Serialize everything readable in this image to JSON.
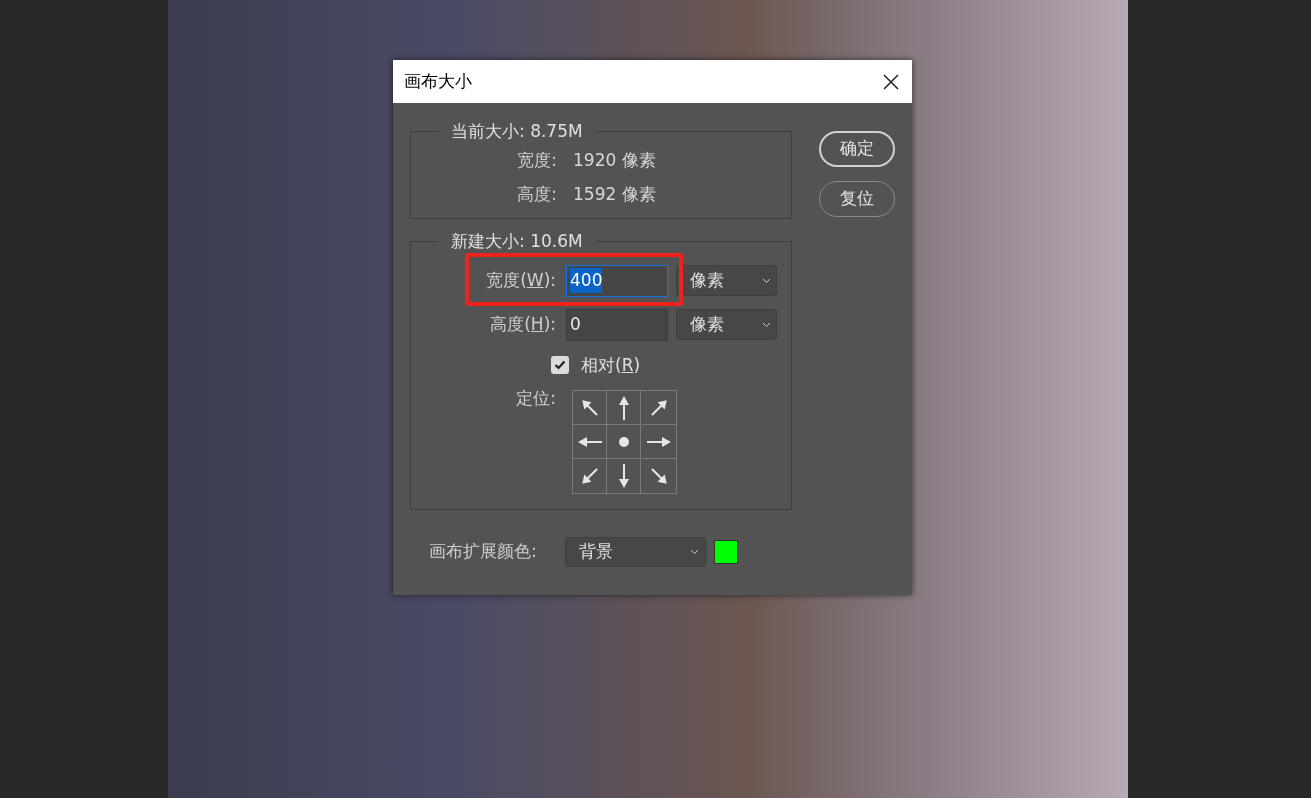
{
  "window": {
    "title": "画布大小"
  },
  "current_size": {
    "legend": "当前大小: 8.75M",
    "rows": [
      {
        "label": "宽度:",
        "value": "1920 像素"
      },
      {
        "label": "高度:",
        "value": "1592 像素"
      }
    ]
  },
  "new_size": {
    "legend": "新建大小: 10.6M",
    "fields": [
      {
        "label_before": "宽度(",
        "mnemonic": "W",
        "label_after": "):",
        "value": "400",
        "focused": true,
        "unit": "像素"
      },
      {
        "label_before": "高度(",
        "mnemonic": "H",
        "label_after": "):",
        "value": "0",
        "focused": false,
        "unit": "像素"
      }
    ],
    "relative": {
      "label_before": "相对(",
      "mnemonic": "R",
      "label_after": ")",
      "checked": true
    },
    "anchor": {
      "label": "定位:",
      "cells": [
        {
          "kind": "nw",
          "selected": false
        },
        {
          "kind": "n",
          "selected": false
        },
        {
          "kind": "ne",
          "selected": false
        },
        {
          "kind": "w",
          "selected": false
        },
        {
          "selected": true
        },
        {
          "kind": "e",
          "selected": false
        },
        {
          "kind": "sw",
          "selected": false
        },
        {
          "kind": "s",
          "selected": false
        },
        {
          "kind": "se",
          "selected": false
        }
      ]
    }
  },
  "extension_color": {
    "label": "画布扩展颜色:",
    "value": "背景",
    "color": "#00ff00"
  },
  "buttons": [
    {
      "label": "确定",
      "default": true
    },
    {
      "label": "复位",
      "default": false
    }
  ]
}
